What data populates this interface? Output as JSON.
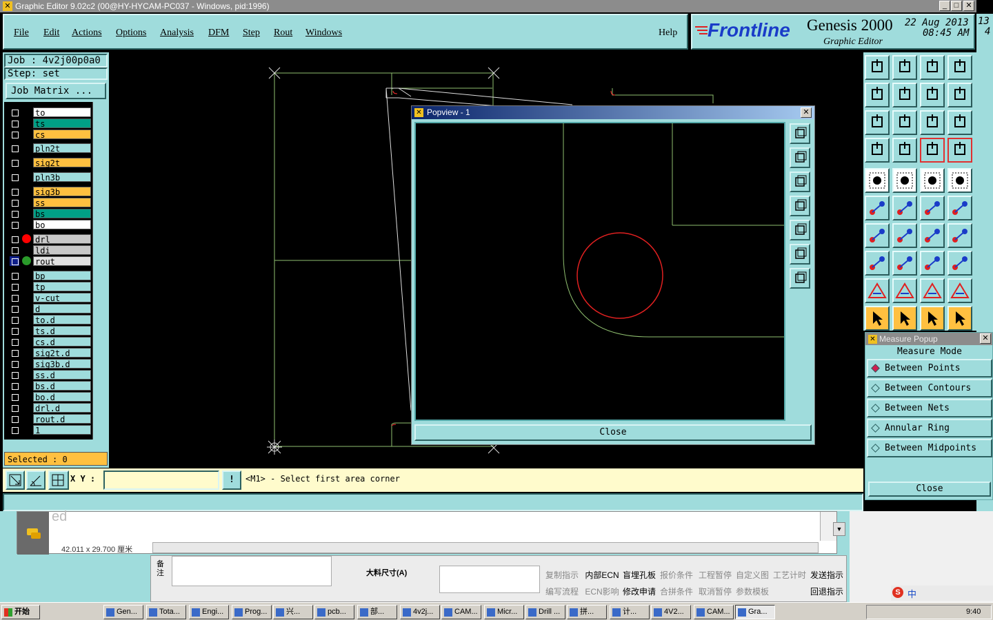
{
  "window": {
    "title": "Graphic Editor 9.02c2 (00@HY-HYCAM-PC037 - Windows, pid:1996)"
  },
  "menu": [
    "File",
    "Edit",
    "Actions",
    "Options",
    "Analysis",
    "DFM",
    "Step",
    "Rout",
    "Windows"
  ],
  "help_label": "Help",
  "brand": {
    "logo": "Frontline",
    "product": "Genesis 2000",
    "subtitle": "Graphic Editor",
    "date": "22 Aug 2013",
    "time": "08:45 AM",
    "edge_date": "13",
    "edge_time": "4"
  },
  "job": {
    "job_label": "Job : 4v2j00p0a0",
    "step_label": "Step: set",
    "matrix_button": "Job Matrix ..."
  },
  "layers": [
    {
      "name": "to",
      "color": "#ffffff"
    },
    {
      "name": "ts",
      "color": "#00a086"
    },
    {
      "name": "cs",
      "color": "#ffc040"
    },
    {
      "name": "pln2t",
      "color": "#9fdcdc"
    },
    {
      "name": "sig2t",
      "color": "#ffc040"
    },
    {
      "name": "pln3b",
      "color": "#9fdcdc"
    },
    {
      "name": "sig3b",
      "color": "#ffc040"
    },
    {
      "name": "ss",
      "color": "#ffc040"
    },
    {
      "name": "bs",
      "color": "#00a086"
    },
    {
      "name": "bo",
      "color": "#ffffff"
    },
    {
      "name": "drl",
      "color": "#c8c8c8",
      "marker": "#ff0000"
    },
    {
      "name": "ldi",
      "color": "#c8c8c8"
    },
    {
      "name": "rout",
      "color": "#e0e0e0",
      "marker": "#2a9a2a"
    },
    {
      "name": "bp",
      "color": "#9fdcdc"
    },
    {
      "name": "tp",
      "color": "#9fdcdc"
    },
    {
      "name": "v-cut",
      "color": "#9fdcdc"
    },
    {
      "name": "d",
      "color": "#9fdcdc"
    },
    {
      "name": "to.d",
      "color": "#9fdcdc"
    },
    {
      "name": "ts.d",
      "color": "#9fdcdc"
    },
    {
      "name": "cs.d",
      "color": "#9fdcdc"
    },
    {
      "name": "sig2t.d",
      "color": "#9fdcdc"
    },
    {
      "name": "sig3b.d",
      "color": "#9fdcdc"
    },
    {
      "name": "ss.d",
      "color": "#9fdcdc"
    },
    {
      "name": "bs.d",
      "color": "#9fdcdc"
    },
    {
      "name": "bo.d",
      "color": "#9fdcdc"
    },
    {
      "name": "drl.d",
      "color": "#9fdcdc"
    },
    {
      "name": "rout.d",
      "color": "#9fdcdc"
    },
    {
      "name": "1",
      "color": "#9fdcdc"
    }
  ],
  "selected_label": "Selected : 0",
  "popview": {
    "title": "Popview - 1",
    "close_label": "Close"
  },
  "measure": {
    "title": "Measure Popup",
    "heading": "Measure Mode",
    "modes": [
      "Between Points",
      "Between Contours",
      "Between Nets",
      "Annular Ring",
      "Between Midpoints"
    ],
    "selected_mode": "Between Points",
    "close_label": "Close"
  },
  "command": {
    "xy_label": "X Y :",
    "xy_value": "",
    "excl": "!",
    "prompt": "<M1> - Select first area corner"
  },
  "behind": {
    "doc_text": "ed",
    "page_size": "42.011 x 29.700 厘米",
    "dim_label": "大料尺寸(A)",
    "side_text": "备注",
    "buttons_row1": [
      "复制指示",
      "内部ECN",
      "盲埋孔板",
      "报价条件",
      "工程暂停",
      "自定义图",
      "工艺计时",
      "发送指示"
    ],
    "buttons_row2": [
      "编写流程",
      "ECN影响",
      "修改申请",
      "合拼条件",
      "取消暂停",
      "参数模板",
      "",
      "回退指示"
    ]
  },
  "taskbar": {
    "start": "开始",
    "tasks": [
      "Gen...",
      "Tota...",
      "Engi...",
      "Prog...",
      "兴...",
      "pcb...",
      "部...",
      "4v2j...",
      "CAM...",
      "Micr...",
      "Drill ...",
      "拼...",
      "计...",
      "4V2...",
      "CAM...",
      "Gra..."
    ],
    "ime": "中",
    "clock": "9:40"
  }
}
